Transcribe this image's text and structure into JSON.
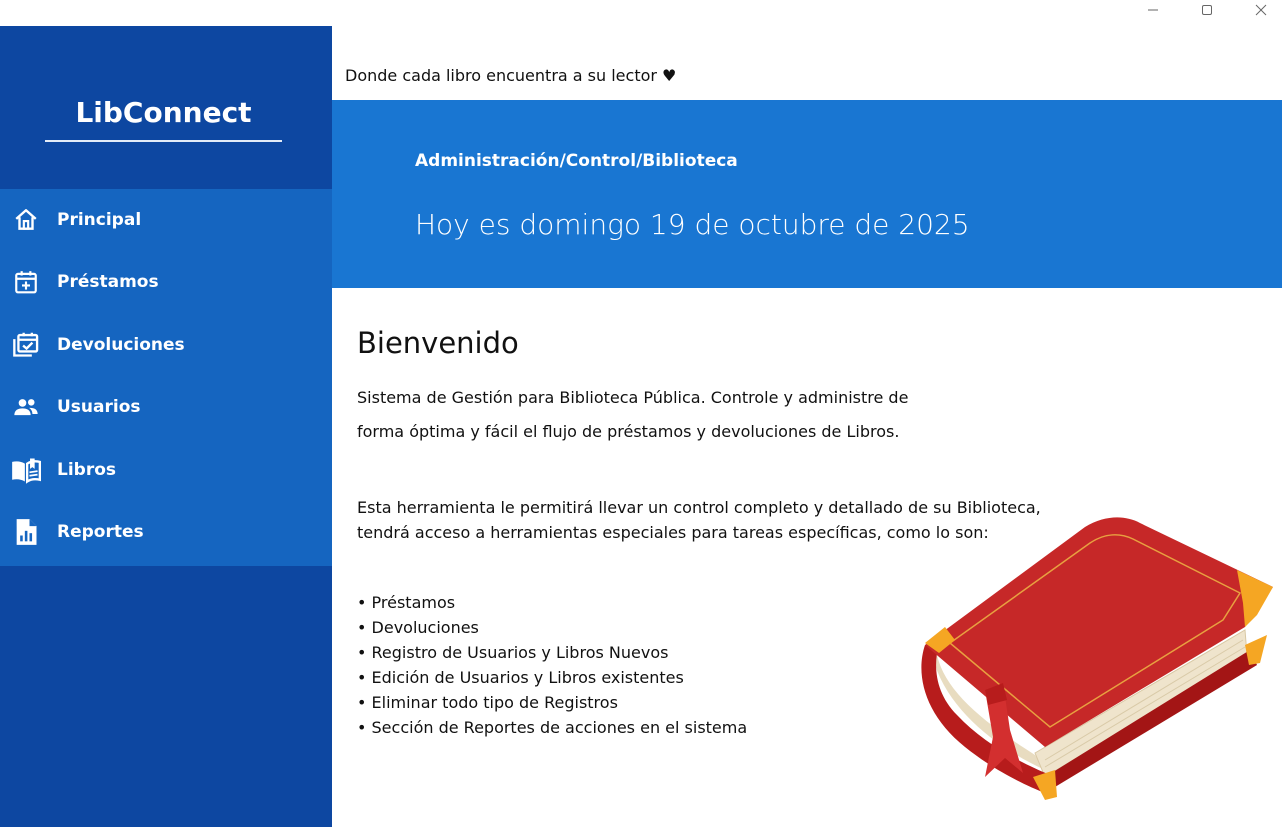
{
  "window": {
    "controls": [
      "minimize-icon",
      "maximize-icon",
      "close-icon"
    ]
  },
  "sidebar": {
    "brand": "LibConnect",
    "items": [
      {
        "label": "Principal",
        "icon": "home-icon"
      },
      {
        "label": "Préstamos",
        "icon": "calendar-plus-icon"
      },
      {
        "label": "Devoluciones",
        "icon": "calendar-check-icon"
      },
      {
        "label": "Usuarios",
        "icon": "users-icon"
      },
      {
        "label": "Libros",
        "icon": "book-open-icon"
      },
      {
        "label": "Reportes",
        "icon": "report-icon"
      }
    ]
  },
  "header": {
    "tagline": "Donde cada libro encuentra a su lector ♥",
    "breadcrumb": "Administración/Control/Biblioteca",
    "date": "Hoy es domingo 19 de octubre de 2025"
  },
  "main": {
    "title": "Bienvenido",
    "intro_line1": "Sistema de Gestión para Biblioteca Pública. Controle y administre de",
    "intro_line2": "forma óptima y fácil el flujo de préstamos y devoluciones de Libros.",
    "detail_line1": "Esta herramienta le permitirá llevar un control completo y detallado de su Biblioteca,",
    "detail_line2": "tendrá acceso a herramientas especiales para tareas específicas, como lo son:",
    "features": [
      "• Préstamos",
      "• Devoluciones",
      "• Registro de Usuarios y Libros Nuevos",
      "• Edición de Usuarios y Libros existentes",
      "• Eliminar todo tipo de Registros",
      "• Sección de Reportes de acciones en el sistema"
    ]
  },
  "colors": {
    "sidebar_dark": "#0d47a1",
    "sidebar_nav": "#1565c0",
    "banner": "#1976d2",
    "book_red": "#c62828",
    "book_gold": "#f5a623"
  }
}
